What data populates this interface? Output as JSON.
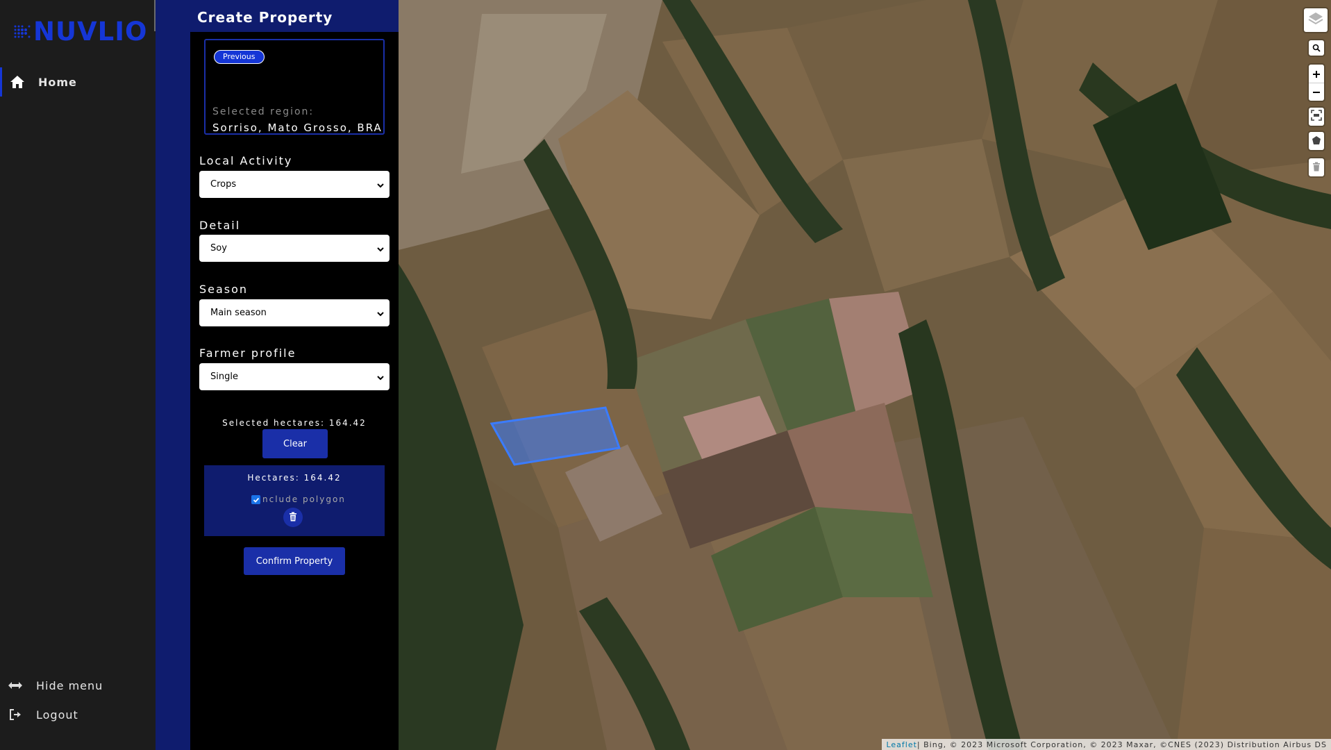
{
  "sidebar": {
    "logo_text": "NUVLIO",
    "nav": [
      {
        "label": "Home",
        "icon": "home-icon",
        "active": true
      }
    ],
    "hide_menu_label": "Hide menu",
    "logout_label": "Logout"
  },
  "panel": {
    "title": "Create Property",
    "previous_label": "Previous",
    "region_caption": "Selected region:",
    "region_value": "Sorriso, Mato Grosso, BRA",
    "fields": {
      "local_activity": {
        "label": "Local Activity",
        "value": "Crops"
      },
      "detail": {
        "label": "Detail",
        "value": "Soy"
      },
      "season": {
        "label": "Season",
        "value": "Main season"
      },
      "farmer_profile": {
        "label": "Farmer profile",
        "value": "Single"
      }
    },
    "selected_hectares": "Selected hectares: 164.42",
    "clear_label": "Clear",
    "polygon": {
      "hectares": "Hectares: 164.42",
      "include_label": "nclude polygon",
      "include_checked": true
    },
    "confirm_label": "Confirm Property"
  },
  "map": {
    "controls": [
      "layers-icon",
      "search-icon",
      "zoom-in-icon",
      "zoom-out-icon",
      "draw-rectangle-icon",
      "draw-polygon-icon",
      "delete-layers-icon"
    ],
    "attribution_link": "Leaflet",
    "attribution_text": " | Bing, © 2023 Microsoft Corporation, © 2023 Maxar, ©CNES (2023) Distribution Airbus DS",
    "selection_color": "#3b7cff"
  },
  "colors": {
    "brand": "#1536d6",
    "panel_bg": "#0f1c6e",
    "button": "#1a2fa8",
    "sidebar_bg": "#1c1c1c"
  }
}
